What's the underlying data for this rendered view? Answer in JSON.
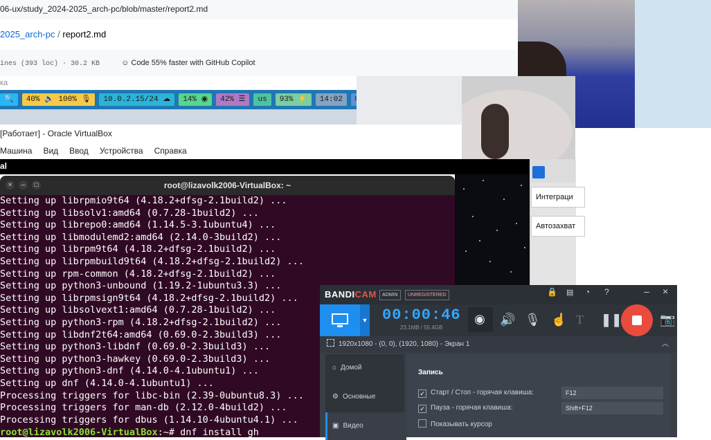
{
  "github": {
    "url": "06-ux/study_2024-2025_arch-pc/blob/master/report2.md",
    "breadcrumb_repo": "2025_arch-pc",
    "breadcrumb_sep": "/",
    "breadcrumb_file": "report2.md",
    "meta_lines": "ines (393 loc) · 30.2 KB",
    "copilot": "Code 55% faster with GitHub Copilot"
  },
  "search": {
    "text": "ка"
  },
  "status_bar": {
    "segments": [
      {
        "text": "🔍",
        "bg": "#29b6f6"
      },
      {
        "text": "40% 🔈 100% 🎙",
        "bg": "#f7c948"
      },
      {
        "text": "10.0.2.15/24 ☁",
        "bg": "#2bb4d8"
      },
      {
        "text": "14% ◉",
        "bg": "#58d68d"
      },
      {
        "text": "42% ☰",
        "bg": "#af7ac5"
      },
      {
        "text": "us",
        "bg": "#4fc3a1"
      },
      {
        "text": "93% ⚡",
        "bg": "#7dcea0"
      },
      {
        "text": "14:02",
        "bg": "#85a3c2"
      },
      {
        "text": "⧉",
        "bg": "#5d8fd6"
      }
    ]
  },
  "vbox": {
    "title": "[Работает] - Oracle VirtualBox",
    "menu": [
      "Машина",
      "Вид",
      "Ввод",
      "Устройства",
      "Справка"
    ]
  },
  "guest": {
    "topbar_label": "al"
  },
  "terminal": {
    "title": "root@lizavolk2006-VirtualBox: ~",
    "lines": [
      "Setting up librpmio9t64 (4.18.2+dfsg-2.1build2) ...",
      "Setting up libsolv1:amd64 (0.7.28-1build2) ...",
      "Setting up librepo0:amd64 (1.14.5-3.1ubuntu4) ...",
      "Setting up libmodulemd2:amd64 (2.14.0-3build2) ...",
      "Setting up librpm9t64 (4.18.2+dfsg-2.1build2) ...",
      "Setting up librpmbuild9t64 (4.18.2+dfsg-2.1build2) ...",
      "Setting up rpm-common (4.18.2+dfsg-2.1build2) ...",
      "Setting up python3-unbound (1.19.2-1ubuntu3.3) ...",
      "Setting up librpmsign9t64 (4.18.2+dfsg-2.1build2) ...",
      "Setting up libsolvext1:amd64 (0.7.28-1build2) ...",
      "Setting up python3-rpm (4.18.2+dfsg-2.1build2) ...",
      "Setting up libdnf2t64:amd64 (0.69.0-2.3build3) ...",
      "Setting up python3-libdnf (0.69.0-2.3build3) ...",
      "Setting up python3-hawkey (0.69.0-2.3build3) ...",
      "Setting up python3-dnf (4.14.0-4.1ubuntu1) ...",
      "Setting up dnf (4.14.0-4.1ubuntu1) ...",
      "Processing triggers for libc-bin (2.39-0ubuntu8.3) ...",
      "Processing triggers for man-db (2.12.0-4build2) ...",
      "Processing triggers for dbus (1.14.10-4ubuntu4.1) ..."
    ],
    "prompt_user": "root@lizavolk2006-VirtualBox",
    "prompt_rest": ":~# dnf install gh",
    "prompt_color": "#8ae234"
  },
  "integration_panel": {
    "button1": "Интеграци",
    "button2": "Автозахват"
  },
  "bandicam": {
    "logo_a": "BANDI",
    "logo_b": "CAM",
    "badge_admin": "ADMIN",
    "badge_unreg": "UNREGISTERED",
    "timer": "00:00:46",
    "size": "23.1MB / 55.4GB",
    "resolution": "1920x1080 - (0, 0), (1920, 1080) - Экран 1",
    "nav": [
      "Домой",
      "Основные",
      "Видео"
    ],
    "section_title": "Запись",
    "rows": [
      {
        "label": "Старт / Стоп - горячая клавиша:",
        "checked": true,
        "key": "F12"
      },
      {
        "label": "Пауза - горячая клавиша:",
        "checked": true,
        "key": "Shift+F12"
      },
      {
        "label": "Показывать курсор",
        "checked": false,
        "key": ""
      }
    ]
  }
}
